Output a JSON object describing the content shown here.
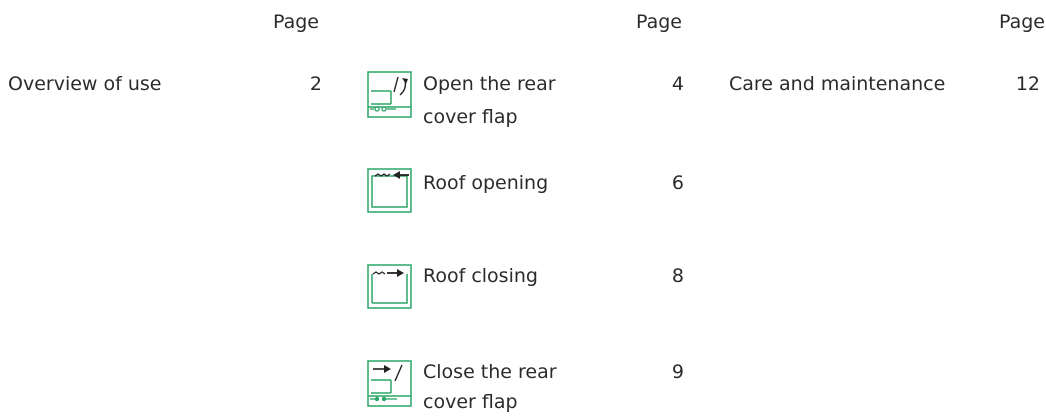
{
  "columns": [
    {
      "page_header": "Page",
      "entries": [
        {
          "label": "Overview of use",
          "page": "2"
        }
      ]
    },
    {
      "page_header": "Page",
      "entries": [
        {
          "label_line1": "Open the rear",
          "label_line2": "cover flap",
          "page": "4",
          "icon": "open-rear-cover-flap-icon"
        },
        {
          "label_line1": "Roof opening",
          "page": "6",
          "icon": "roof-opening-icon"
        },
        {
          "label_line1": "Roof closing",
          "page": "8",
          "icon": "roof-closing-icon"
        },
        {
          "label_line1": "Close the rear",
          "label_line2": "cover flap",
          "page": "9",
          "icon": "close-rear-cover-flap-icon"
        }
      ]
    },
    {
      "page_header": "Page",
      "entries": [
        {
          "label": "Care and maintenance",
          "page": "12"
        }
      ]
    }
  ],
  "colors": {
    "icon_green": "#2aa566",
    "icon_dark": "#222222",
    "text": "#2b2b2b"
  }
}
